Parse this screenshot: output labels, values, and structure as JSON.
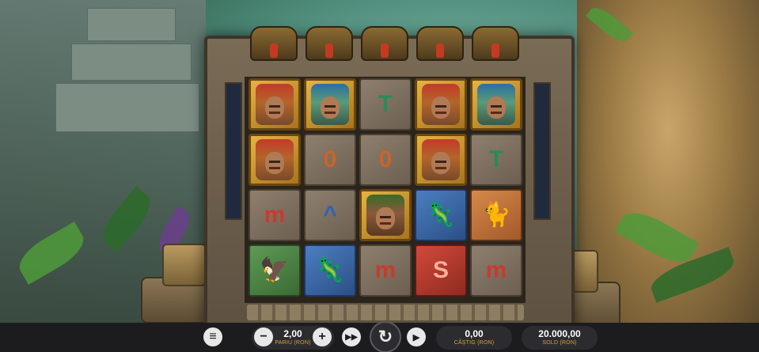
{
  "controls": {
    "menu_icon": "menu-icon",
    "bet_value": "2,00",
    "bet_label": "PARIU (RON)",
    "minus": "−",
    "plus": "+",
    "win_value": "0,00",
    "win_label": "CÂȘTIG (RON)",
    "balance_value": "20.000,00",
    "balance_label": "SOLD (RON)",
    "spin_symbol": "↻",
    "turbo_symbol": "▶▶",
    "autoplay_symbol": "▶"
  },
  "reels": [
    [
      {
        "type": "face",
        "variant": "red",
        "tile": "gold",
        "name": "red-headdress-chief"
      },
      {
        "type": "face",
        "variant": "red",
        "tile": "gold",
        "name": "red-headdress-chief"
      },
      {
        "type": "glyph",
        "symbol": "m",
        "tile": "stone",
        "color": "#c93a2e",
        "name": "red-m-glyph"
      },
      {
        "type": "glyph",
        "symbol": "🦅",
        "tile": "greentile",
        "color": "#2f5a2b",
        "name": "green-eagle-tile"
      }
    ],
    [
      {
        "type": "face",
        "variant": "blue",
        "tile": "gold",
        "name": "blue-woman-portrait"
      },
      {
        "type": "glyph",
        "symbol": "0",
        "tile": "stone",
        "color": "#c9642a",
        "name": "orange-zero-glyph"
      },
      {
        "type": "glyph",
        "symbol": "^",
        "tile": "stone",
        "color": "#2f62b8",
        "name": "blue-chevron-glyph"
      },
      {
        "type": "glyph",
        "symbol": "🦎",
        "tile": "bluetile",
        "color": "#7fb7ff",
        "name": "blue-lizard-tile"
      }
    ],
    [
      {
        "type": "glyph",
        "symbol": "T",
        "tile": "stone",
        "color": "#2a8a5a",
        "name": "green-mushroom-glyph"
      },
      {
        "type": "glyph",
        "symbol": "0",
        "tile": "stone",
        "color": "#c9642a",
        "name": "orange-zero-glyph"
      },
      {
        "type": "face",
        "variant": "warrior",
        "tile": "gold",
        "name": "warrior-portrait"
      },
      {
        "type": "glyph",
        "symbol": "m",
        "tile": "stone",
        "color": "#c93a2e",
        "name": "red-m-glyph"
      }
    ],
    [
      {
        "type": "face",
        "variant": "red",
        "tile": "gold",
        "name": "red-headdress-chief"
      },
      {
        "type": "face",
        "variant": "red",
        "tile": "gold",
        "name": "red-headdress-chief"
      },
      {
        "type": "glyph",
        "symbol": "🦎",
        "tile": "bluetile",
        "color": "#7fb7ff",
        "name": "blue-lizard-tile"
      },
      {
        "type": "glyph",
        "symbol": "S",
        "tile": "redtile",
        "color": "#ffb0a0",
        "name": "red-serpent-tile"
      }
    ],
    [
      {
        "type": "face",
        "variant": "blue",
        "tile": "gold",
        "name": "blue-woman-portrait"
      },
      {
        "type": "glyph",
        "symbol": "T",
        "tile": "stone",
        "color": "#2a8a5a",
        "name": "green-mushroom-glyph"
      },
      {
        "type": "glyph",
        "symbol": "🐈",
        "tile": "orangetile",
        "color": "#f0b070",
        "name": "orange-jaguar-tile"
      },
      {
        "type": "glyph",
        "symbol": "m",
        "tile": "stone",
        "color": "#c93a2e",
        "name": "red-m-glyph"
      }
    ]
  ]
}
